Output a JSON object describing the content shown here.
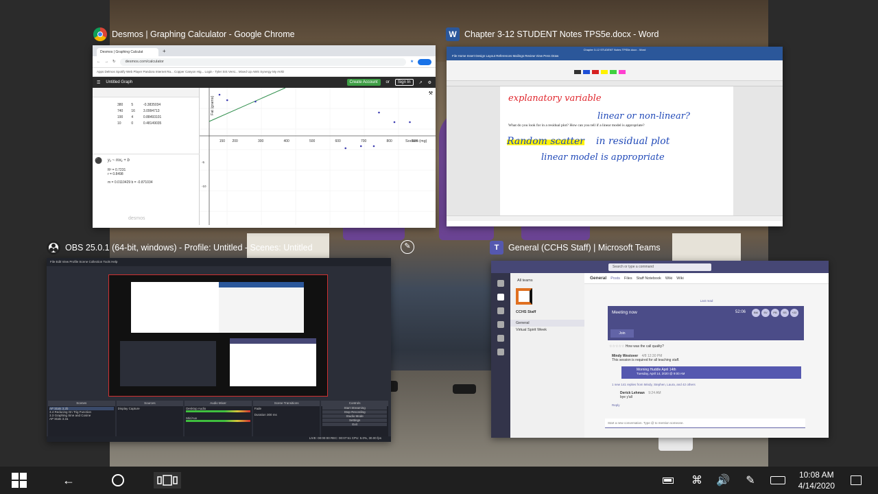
{
  "windows": {
    "desmos": {
      "title": "Desmos | Graphing Calculator - Google Chrome",
      "tab_label": "Desmos | Graphing Calculat",
      "url": "desmos.com/calculator",
      "bookmarks": "Apps  Delmos  Spotify Web Player  Pandora Internet Ra...  Copper Canyon Hig...  Login - Tyler SIS Versi...  Mixed Up AWS  Synergy  My AVID",
      "graph_title": "Untitled Graph",
      "logo": "desmos",
      "create_account": "Create Account",
      "or": "or",
      "sign_in": "Sign In",
      "table": [
        [
          "380",
          "5",
          "-0.3835034"
        ],
        [
          "740",
          "16",
          "3.0994713"
        ],
        [
          "190",
          "4",
          "0.88493101"
        ],
        [
          "10",
          "0",
          "0.48149035"
        ]
      ],
      "regression": "y₁ ~ mx₁ + b",
      "stats": [
        "R² = 0.7231",
        "r = 0.8498"
      ],
      "params": "m = 0.0110429    b = -0.871034",
      "x_axis_label": "Sodium (mg)",
      "y_axis_label": "Fat (grams)",
      "x_ticks": [
        "150",
        "200",
        "300",
        "400",
        "500",
        "600",
        "700",
        "800",
        "900"
      ],
      "y_ticks": [
        "-5",
        "-10"
      ]
    },
    "word": {
      "title": "Chapter 3-12 STUDENT Notes TPS5e.docx - Word",
      "window_caption": "Chapter 3-12 STUDENT Notes TPS5e.docx - Word",
      "tabs": "File  Home  Insert  Design  Layout  References  Mailings  Review  View  Pens  Draw",
      "ink_1": "explanatory variable",
      "question": "What do you look for in a residual plot?  How can you tell if a linear model is appropriate?",
      "ink_2": "linear or non-linear?",
      "ink_3a": "Random scatter",
      "ink_3b": "in residual plot",
      "ink_4": "linear model is appropriate"
    },
    "obs": {
      "title": "OBS 25.0.1 (64-bit, windows) - Profile: Untitled - Scenes: Untitled",
      "menu": "File  Edit  View  Profile  Scene Collection  Tools  Help",
      "scenes_header": "Scenes",
      "sources_header": "Sources",
      "mixer_header": "Audio Mixer",
      "transitions_header": "Scene Transitions",
      "controls_header": "Controls",
      "scenes": [
        "AP Stats 3.2b",
        "3.4 Reducing On Trig Function",
        "3.3 Graphing Sine and Cosine",
        "AP Stats 3.2a"
      ],
      "source": "Display Capture",
      "controls": [
        "Start Streaming",
        "Stop Recording",
        "Studio Mode",
        "Settings",
        "Exit"
      ],
      "mixer_channels": [
        "Desktop Audio",
        "Mic/Aux"
      ],
      "transition": "Fade",
      "duration": "Duration  300 ms",
      "status": "LIVE: 00:00:00    REC: 00:07:51    CPU: 5.0%, 30.00 fps"
    },
    "teams": {
      "title": "General (CCHS Staff) | Microsoft Teams",
      "search": "Search or type a command",
      "all_teams": "All teams",
      "team_name": "CCHS Staff",
      "channels": [
        "General",
        "Virtual Spirit Week"
      ],
      "channel": "General",
      "channel_tabs": [
        "Posts",
        "Files",
        "Staff Notebook",
        "Wiki",
        "Wiki"
      ],
      "last_read": "Last read",
      "meeting_now": "Meeting now",
      "meeting_time": "52:06",
      "join": "Join",
      "quality_question": "How was the call quality?",
      "poster": "Mindy Westover",
      "posted_time": "4/8 12:30 PM",
      "post_text": "This session is required for all teaching staff.",
      "event_title": "Morning Huddle April 14th",
      "event_time": "Tuesday, April 14, 2020 @ 9:00 AM",
      "replies": "1 new   141 replies from Mindy, Stephen, Laura, and 42 others",
      "reply_name": "Derick Lehman",
      "reply_time": "9:24 AM",
      "reply_text": "bye y'all",
      "reply_link": "Reply",
      "compose": "Start a new conversation. Type @ to mention someone.",
      "avatars": [
        "BM",
        "SV",
        "PB",
        "SS",
        "+22"
      ]
    }
  },
  "taskbar": {
    "time": "10:08 AM",
    "date": "4/14/2020"
  },
  "colors": {
    "teams_purple": "#464775",
    "word_blue": "#2b579a",
    "desmos_green": "#3e9e45",
    "chrome_red": "#db4437",
    "ink_red": "#e0242b",
    "ink_blue": "#2049b8",
    "highlight_yellow": "#fff200"
  }
}
